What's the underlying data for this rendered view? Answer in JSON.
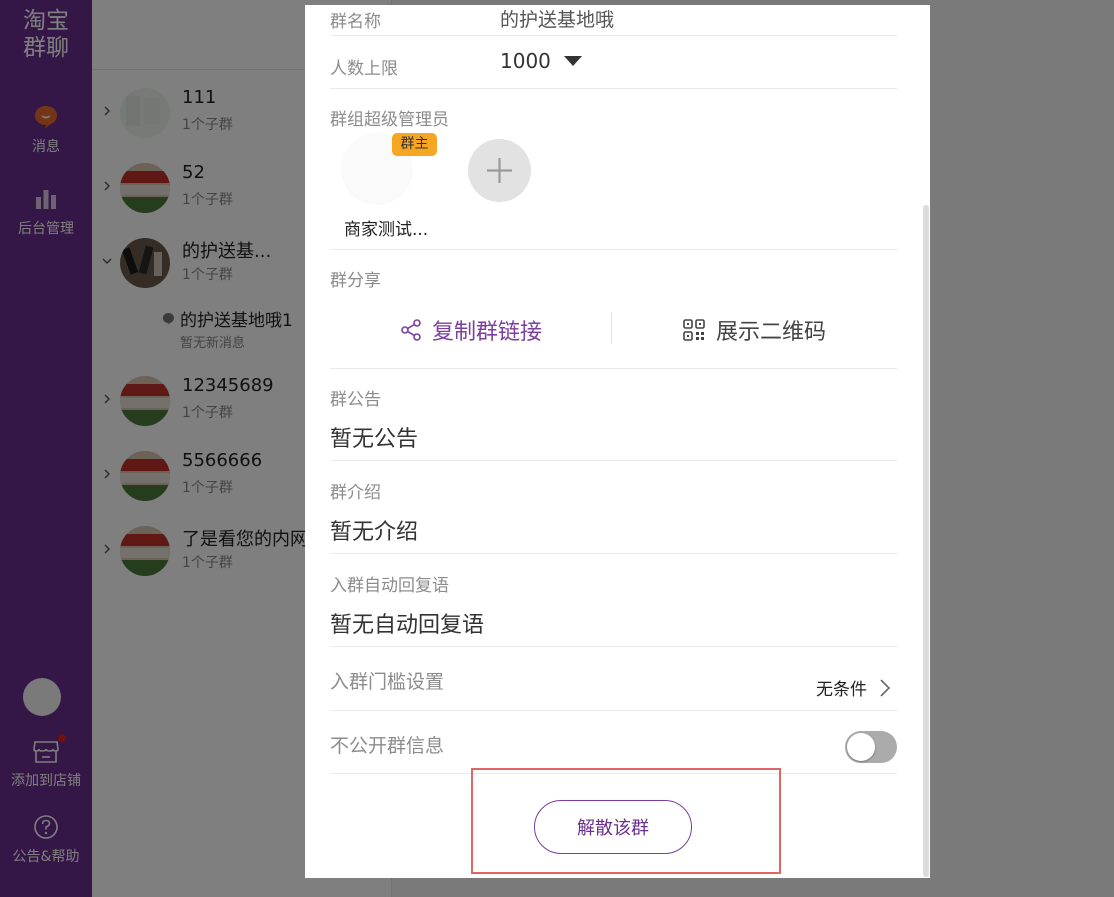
{
  "sidebar": {
    "logo_line1": "淘宝",
    "logo_line2": "群聊",
    "items": [
      {
        "label": "消息"
      },
      {
        "label": "后台管理"
      },
      {
        "label": "添加到店铺"
      },
      {
        "label": "公告&帮助"
      }
    ]
  },
  "groups": [
    {
      "name": "111",
      "sub": "1个子群",
      "expanded": false
    },
    {
      "name": "52",
      "sub": "1个子群",
      "expanded": false
    },
    {
      "name": "的护送基...",
      "sub": "1个子群",
      "expanded": true
    },
    {
      "name": "12345689",
      "sub": "1个子群",
      "expanded": false
    },
    {
      "name": "5566666",
      "sub": "1个子群",
      "expanded": false
    },
    {
      "name": "了是看您的内网",
      "sub": "1个子群",
      "expanded": false
    }
  ],
  "subgroup": {
    "name": "的护送基地哦1",
    "status": "暂无新消息"
  },
  "modal": {
    "group_name_label": "群名称",
    "group_name_value": "的护送基地哦",
    "member_limit_label": "人数上限",
    "member_limit_value": "1000",
    "admins_label": "群组超级管理员",
    "owner_badge": "群主",
    "admin_name": "商家测试...",
    "share_label": "群分享",
    "copy_link": "复制群链接",
    "show_qr": "展示二维码",
    "announcement_label": "群公告",
    "announcement_value": "暂无公告",
    "intro_label": "群介绍",
    "intro_value": "暂无介绍",
    "autoreply_label": "入群自动回复语",
    "autoreply_value": "暂无自动回复语",
    "threshold_label": "入群门槛设置",
    "threshold_value": "无条件",
    "private_label": "不公开群信息",
    "private_enabled": false,
    "dissolve_button": "解散该群"
  },
  "colors": {
    "brand": "#6b2f8e",
    "owner_badge": "#f5a623",
    "highlight": "#e06666"
  }
}
